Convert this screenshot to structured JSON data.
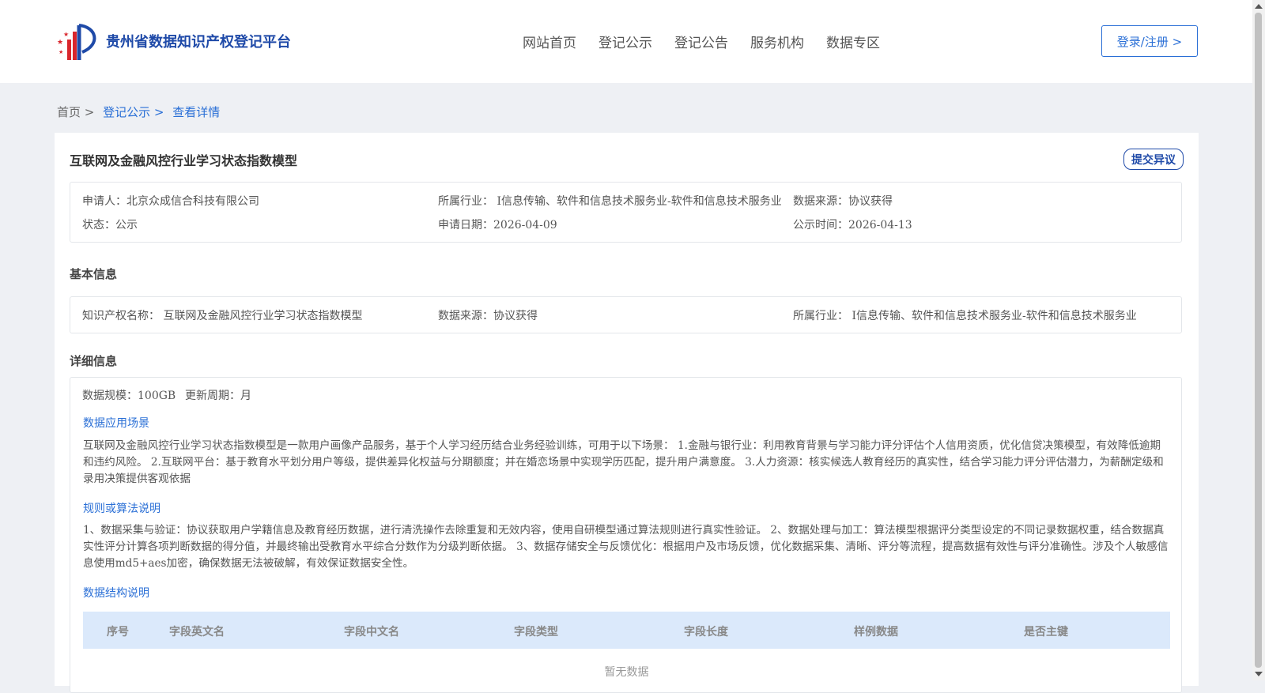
{
  "header": {
    "logo_text": "贵州省数据知识产权登记平台",
    "nav": [
      "网站首页",
      "登记公示",
      "登记公告",
      "服务机构",
      "数据专区"
    ],
    "login_label": "登录/注册 >"
  },
  "breadcrumb": {
    "home": "首页 >",
    "level1": "登记公示 >",
    "current": "查看详情"
  },
  "detail": {
    "title": "互联网及金融风控行业学习状态指数模型",
    "objection_label": "提交异议",
    "summary": {
      "applicant": "申请人：北京众成信合科技有限公司",
      "industry": "所属行业： I信息传输、软件和信息技术服务业-软件和信息技术服务业",
      "data_source": "数据来源：协议获得",
      "status": "状态：公示",
      "apply_date": "申请日期：2026-04-09",
      "publish_time": "公示时间：2026-04-13"
    },
    "basic": {
      "section_title": "基本信息",
      "ip_name": "知识产权名称： 互联网及金融风控行业学习状态指数模型",
      "data_source": "数据来源：协议获得",
      "industry": "所属行业： I信息传输、软件和信息技术服务业-软件和信息技术服务业"
    },
    "details": {
      "section_title": "详细信息",
      "scale": "数据规模：100GB",
      "cycle": "更新周期：月",
      "scene_title": "数据应用场景",
      "scene_text": "互联网及金融风控行业学习状态指数模型是一款用户画像产品服务，基于个人学习经历结合业务经验训练，可用于以下场景： 1.金融与银行业：利用教育背景与学习能力评分评估个人信用资质，优化信贷决策模型，有效降低逾期和违约风险。 2.互联网平台：基于教育水平划分用户等级，提供差异化权益与分期额度；并在婚恋场景中实现学历匹配，提升用户满意度。 3.人力资源：核实候选人教育经历的真实性，结合学习能力评分评估潜力，为薪酬定级和录用决策提供客观依据",
      "rule_title": "规则或算法说明",
      "rule_text": "1、数据采集与验证：协议获取用户学籍信息及教育经历数据，进行清洗操作去除重复和无效内容，使用自研模型通过算法规则进行真实性验证。 2、数据处理与加工：算法模型根据评分类型设定的不同记录数据权重，结合数据真实性评分计算各项判断数据的得分值，并最终输出受教育水平综合分数作为分级判断依据。 3、数据存储安全与反馈优化：根据用户及市场反馈，优化数据采集、清晰、评分等流程，提高数据有效性与评分准确性。涉及个人敏感信息使用md5+aes加密，确保数据无法被破解，有效保证数据安全性。",
      "structure_title": "数据结构说明",
      "table_headers": [
        "序号",
        "字段英文名",
        "字段中文名",
        "字段类型",
        "字段长度",
        "样例数据",
        "是否主键"
      ],
      "empty_text": "暂无数据"
    }
  },
  "colors": {
    "brand_blue": "#1f4aa8",
    "link_blue": "#2a6fd6",
    "table_head_bg": "#dbe9fb"
  }
}
